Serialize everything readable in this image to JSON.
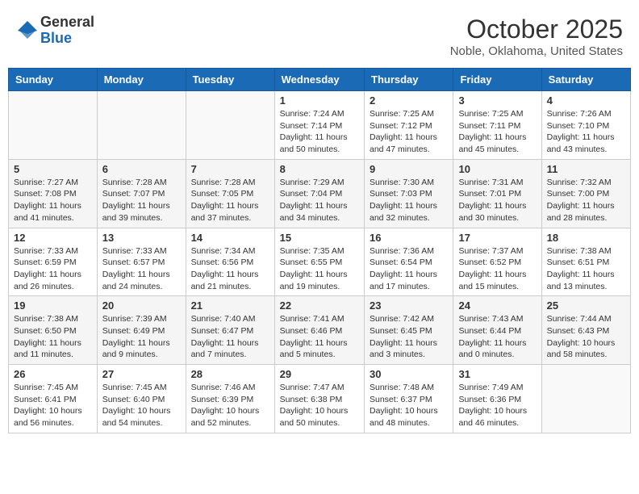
{
  "header": {
    "logo_general": "General",
    "logo_blue": "Blue",
    "title": "October 2025",
    "subtitle": "Noble, Oklahoma, United States"
  },
  "days_of_week": [
    "Sunday",
    "Monday",
    "Tuesday",
    "Wednesday",
    "Thursday",
    "Friday",
    "Saturday"
  ],
  "weeks": [
    [
      {
        "day": "",
        "info": ""
      },
      {
        "day": "",
        "info": ""
      },
      {
        "day": "",
        "info": ""
      },
      {
        "day": "1",
        "info": "Sunrise: 7:24 AM\nSunset: 7:14 PM\nDaylight: 11 hours\nand 50 minutes."
      },
      {
        "day": "2",
        "info": "Sunrise: 7:25 AM\nSunset: 7:12 PM\nDaylight: 11 hours\nand 47 minutes."
      },
      {
        "day": "3",
        "info": "Sunrise: 7:25 AM\nSunset: 7:11 PM\nDaylight: 11 hours\nand 45 minutes."
      },
      {
        "day": "4",
        "info": "Sunrise: 7:26 AM\nSunset: 7:10 PM\nDaylight: 11 hours\nand 43 minutes."
      }
    ],
    [
      {
        "day": "5",
        "info": "Sunrise: 7:27 AM\nSunset: 7:08 PM\nDaylight: 11 hours\nand 41 minutes."
      },
      {
        "day": "6",
        "info": "Sunrise: 7:28 AM\nSunset: 7:07 PM\nDaylight: 11 hours\nand 39 minutes."
      },
      {
        "day": "7",
        "info": "Sunrise: 7:28 AM\nSunset: 7:05 PM\nDaylight: 11 hours\nand 37 minutes."
      },
      {
        "day": "8",
        "info": "Sunrise: 7:29 AM\nSunset: 7:04 PM\nDaylight: 11 hours\nand 34 minutes."
      },
      {
        "day": "9",
        "info": "Sunrise: 7:30 AM\nSunset: 7:03 PM\nDaylight: 11 hours\nand 32 minutes."
      },
      {
        "day": "10",
        "info": "Sunrise: 7:31 AM\nSunset: 7:01 PM\nDaylight: 11 hours\nand 30 minutes."
      },
      {
        "day": "11",
        "info": "Sunrise: 7:32 AM\nSunset: 7:00 PM\nDaylight: 11 hours\nand 28 minutes."
      }
    ],
    [
      {
        "day": "12",
        "info": "Sunrise: 7:33 AM\nSunset: 6:59 PM\nDaylight: 11 hours\nand 26 minutes."
      },
      {
        "day": "13",
        "info": "Sunrise: 7:33 AM\nSunset: 6:57 PM\nDaylight: 11 hours\nand 24 minutes."
      },
      {
        "day": "14",
        "info": "Sunrise: 7:34 AM\nSunset: 6:56 PM\nDaylight: 11 hours\nand 21 minutes."
      },
      {
        "day": "15",
        "info": "Sunrise: 7:35 AM\nSunset: 6:55 PM\nDaylight: 11 hours\nand 19 minutes."
      },
      {
        "day": "16",
        "info": "Sunrise: 7:36 AM\nSunset: 6:54 PM\nDaylight: 11 hours\nand 17 minutes."
      },
      {
        "day": "17",
        "info": "Sunrise: 7:37 AM\nSunset: 6:52 PM\nDaylight: 11 hours\nand 15 minutes."
      },
      {
        "day": "18",
        "info": "Sunrise: 7:38 AM\nSunset: 6:51 PM\nDaylight: 11 hours\nand 13 minutes."
      }
    ],
    [
      {
        "day": "19",
        "info": "Sunrise: 7:38 AM\nSunset: 6:50 PM\nDaylight: 11 hours\nand 11 minutes."
      },
      {
        "day": "20",
        "info": "Sunrise: 7:39 AM\nSunset: 6:49 PM\nDaylight: 11 hours\nand 9 minutes."
      },
      {
        "day": "21",
        "info": "Sunrise: 7:40 AM\nSunset: 6:47 PM\nDaylight: 11 hours\nand 7 minutes."
      },
      {
        "day": "22",
        "info": "Sunrise: 7:41 AM\nSunset: 6:46 PM\nDaylight: 11 hours\nand 5 minutes."
      },
      {
        "day": "23",
        "info": "Sunrise: 7:42 AM\nSunset: 6:45 PM\nDaylight: 11 hours\nand 3 minutes."
      },
      {
        "day": "24",
        "info": "Sunrise: 7:43 AM\nSunset: 6:44 PM\nDaylight: 11 hours\nand 0 minutes."
      },
      {
        "day": "25",
        "info": "Sunrise: 7:44 AM\nSunset: 6:43 PM\nDaylight: 10 hours\nand 58 minutes."
      }
    ],
    [
      {
        "day": "26",
        "info": "Sunrise: 7:45 AM\nSunset: 6:41 PM\nDaylight: 10 hours\nand 56 minutes."
      },
      {
        "day": "27",
        "info": "Sunrise: 7:45 AM\nSunset: 6:40 PM\nDaylight: 10 hours\nand 54 minutes."
      },
      {
        "day": "28",
        "info": "Sunrise: 7:46 AM\nSunset: 6:39 PM\nDaylight: 10 hours\nand 52 minutes."
      },
      {
        "day": "29",
        "info": "Sunrise: 7:47 AM\nSunset: 6:38 PM\nDaylight: 10 hours\nand 50 minutes."
      },
      {
        "day": "30",
        "info": "Sunrise: 7:48 AM\nSunset: 6:37 PM\nDaylight: 10 hours\nand 48 minutes."
      },
      {
        "day": "31",
        "info": "Sunrise: 7:49 AM\nSunset: 6:36 PM\nDaylight: 10 hours\nand 46 minutes."
      },
      {
        "day": "",
        "info": ""
      }
    ]
  ]
}
